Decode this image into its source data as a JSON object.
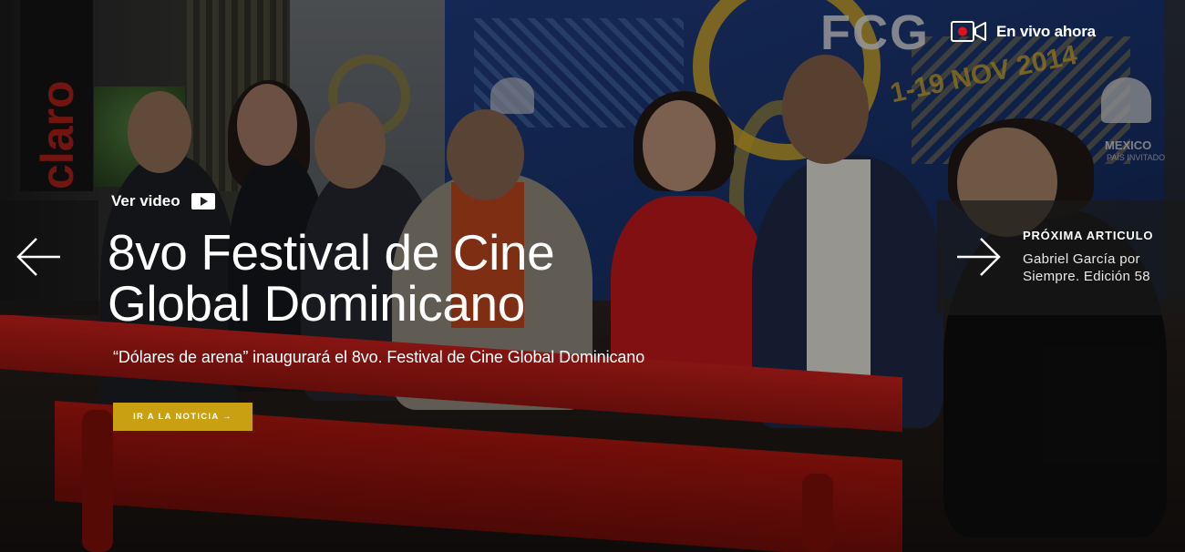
{
  "live": {
    "label": "En vivo ahora",
    "icon": "live-camera-icon"
  },
  "hero": {
    "video_link_label": "Ver video",
    "video_icon": "play-icon",
    "headline": "8vo Festival de Cine Global Dominicano",
    "subheadline": "“Dólares de arena” inaugurará el 8vo. Festival de Cine Global Dominicano",
    "cta_label": "IR A LA NOTICIA →",
    "cta_color": "#c9a012"
  },
  "navigation": {
    "prev_icon": "arrow-left-icon",
    "next_icon": "arrow-right-icon",
    "next_kicker": "PRÓXIMA ARTICULO",
    "next_title": "Gabriel García por Siempre. Edición 58"
  },
  "background": {
    "claro_text": "claro",
    "banner_text": "FCG",
    "banner_date": "1-19 NOV 2014",
    "mexico_label": "MEXICO",
    "mexico_sub": "PAÍS INVITADO"
  }
}
